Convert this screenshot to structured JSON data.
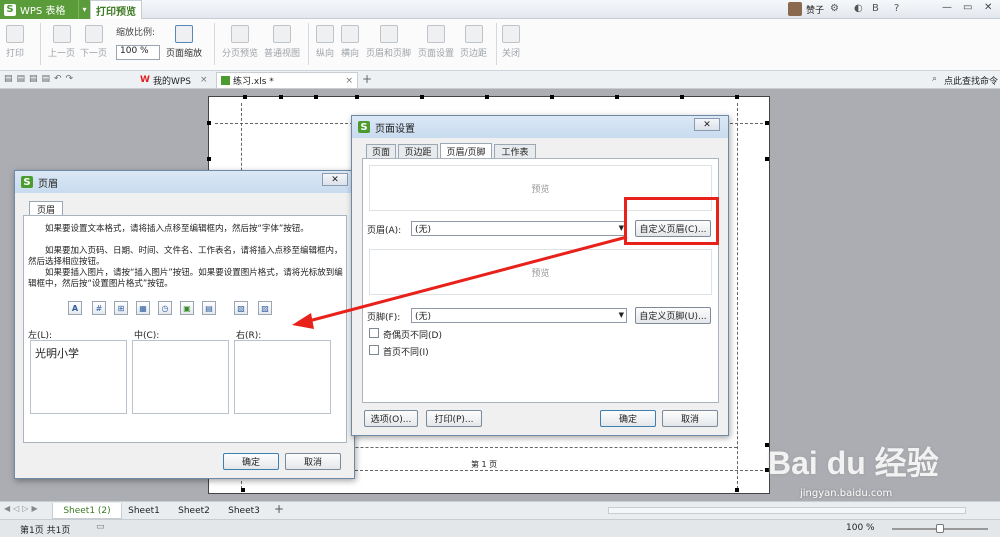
{
  "titlebar": {
    "app_name": "WPS 表格",
    "ribbon_tab": "打印预览",
    "user_name": "赞子",
    "window_controls": [
      "?",
      "—",
      "▭",
      "✕"
    ]
  },
  "ribbon": {
    "print": "打印",
    "prev_page": "上一页",
    "next_page": "下一页",
    "zoom_caption": "缩放比例:",
    "zoom_value": "100 %",
    "page_zoom": "页面缩放",
    "page_break_preview": "分页预览",
    "normal_view": "普通视图",
    "portrait": "纵向",
    "landscape": "横向",
    "header_footer": "页眉和页脚",
    "page_setup": "页面设置",
    "margins": "页边距",
    "close": "关闭"
  },
  "doc_tabs": {
    "wps_tab": "我的WPS",
    "file_tab": "练习.xls *",
    "command_search": "点此查找命令"
  },
  "page_preview": {
    "footer_text": "第 1 页"
  },
  "page_setup_dialog": {
    "title": "页面设置",
    "tabs": [
      "页面",
      "页边距",
      "页眉/页脚",
      "工作表"
    ],
    "preview_top": "预览",
    "header_label": "页眉(A):",
    "header_value": "(无)",
    "custom_header_button": "自定义页眉(C)...",
    "preview_bottom": "预览",
    "footer_label": "页脚(F):",
    "footer_value": "(无)",
    "custom_footer_button": "自定义页脚(U)...",
    "odd_even_diff": "奇偶页不同(D)",
    "first_page_diff": "首页不同(I)",
    "options_button": "选项(O)...",
    "print_button": "打印(P)...",
    "ok_button": "确定",
    "cancel_button": "取消"
  },
  "header_dialog": {
    "title": "页眉",
    "tab": "页眉",
    "instructions": [
      "如果要设置文本格式，请将插入点移至编辑框内，然后按“字体”按钮。",
      "如果要加入页码、日期、时间、文件名、工作表名，请将插入点移至编辑框内，然后选择相应按钮。",
      "如果要插入图片，请按“插入图片”按钮。如果要设置图片格式，请将光标放到编辑框中，然后按“设置图片格式”按钮。"
    ],
    "left_label": "左(L):",
    "center_label": "中(C):",
    "right_label": "右(R):",
    "left_value": "光明小学",
    "center_value": "",
    "right_value": "",
    "ok_button": "确定",
    "cancel_button": "取消"
  },
  "sheet_tabs": [
    "Sheet1 (2)",
    "Sheet1",
    "Sheet2",
    "Sheet3"
  ],
  "statusbar": {
    "page_info": "第1页 共1页",
    "zoom": "100 %"
  },
  "watermark": {
    "brand": "Bai du 经验",
    "url": "jingyan.baidu.com"
  },
  "colors": {
    "wps_green": "#5a9b3a",
    "highlight_red": "#e8221b"
  }
}
